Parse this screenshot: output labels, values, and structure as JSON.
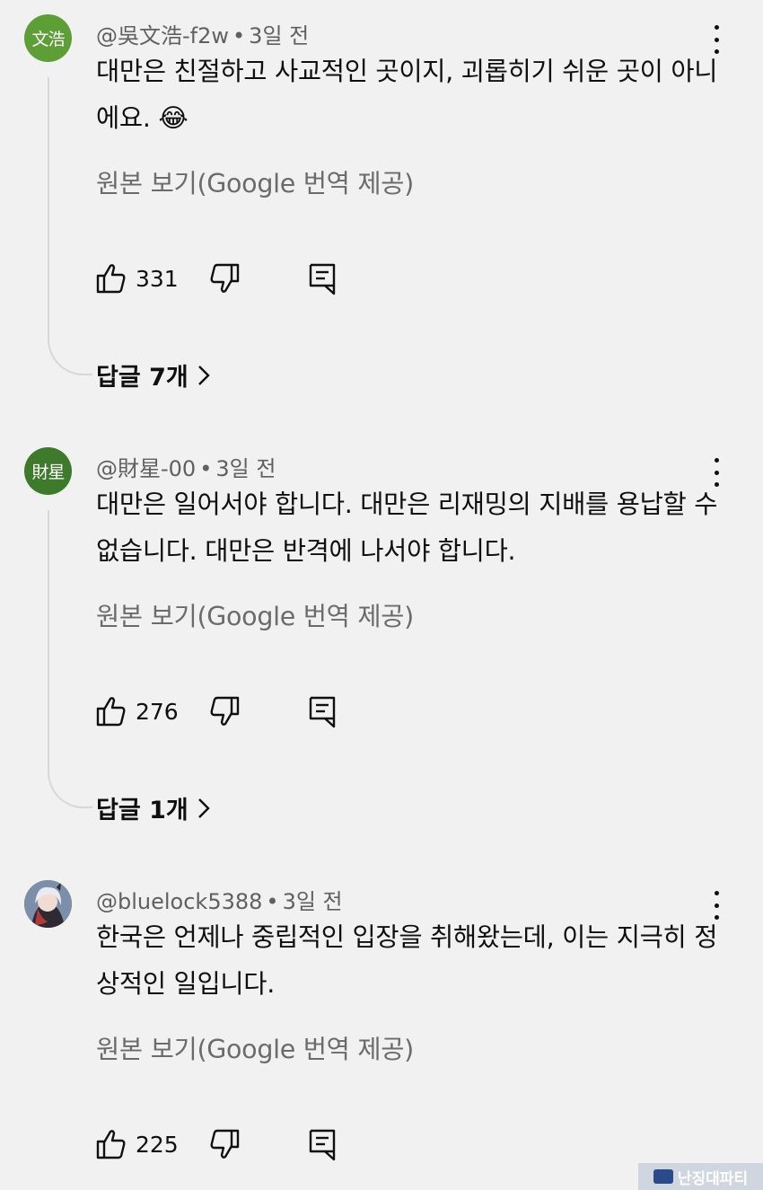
{
  "comments": [
    {
      "avatar_text": "文浩",
      "author": "@吳文浩-f2w",
      "time": "3일 전",
      "text": "대만은 친절하고 사교적인 곳이지, 괴롭히기 쉬운 곳이 아니에요. 😂",
      "translate": "원본 보기(Google 번역 제공)",
      "likes": "331",
      "replies": "답글 7개"
    },
    {
      "avatar_text": "財星",
      "author": "@財星-00",
      "time": "3일 전",
      "text": "대만은 일어서야 합니다. 대만은 리재밍의 지배를 용납할 수 없습니다. 대만은 반격에 나서야 합니다.",
      "translate": "원본 보기(Google 번역 제공)",
      "likes": "276",
      "replies": "답글 1개"
    },
    {
      "avatar_text": "",
      "author": "@bluelock5388",
      "time": "3일 전",
      "text": "한국은 언제나 중립적인 입장을 취해왔는데, 이는 지극히 정상적인 일입니다.",
      "translate": "원본 보기(Google 번역 제공)",
      "likes": "225"
    }
  ],
  "separator": "•",
  "watermark": "난징대파티",
  "icons": [
    "thumb-up-icon",
    "thumb-down-icon",
    "reply-icon",
    "more-vert-icon",
    "chevron-right-icon"
  ]
}
